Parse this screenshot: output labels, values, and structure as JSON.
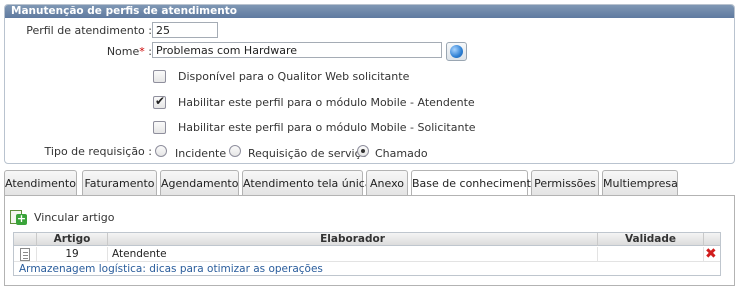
{
  "form": {
    "title": "Manutenção de perfis de atendimento",
    "perfil_label": "Perfil de atendimento :",
    "perfil_value": "25",
    "nome_label": "Nome",
    "nome_required": "*",
    "nome_colon": ":",
    "nome_value": "Problemas com Hardware",
    "checkboxes": [
      {
        "label": "Disponível para o Qualitor Web solicitante",
        "checked": false
      },
      {
        "label": "Habilitar este perfil para o módulo Mobile - Atendente",
        "checked": true
      },
      {
        "label": "Habilitar este perfil para o módulo Mobile - Solicitante",
        "checked": false
      }
    ],
    "tipo_label": "Tipo de requisição :",
    "radios": [
      {
        "label": "Incidente",
        "selected": false
      },
      {
        "label": "Requisição de serviço",
        "selected": false
      },
      {
        "label": "Chamado",
        "selected": true
      }
    ]
  },
  "tabs": [
    {
      "label": "Atendimento",
      "active": false
    },
    {
      "label": "Faturamento",
      "active": false
    },
    {
      "label": "Agendamento",
      "active": false
    },
    {
      "label": "Atendimento tela única",
      "active": false
    },
    {
      "label": "Anexo",
      "active": false
    },
    {
      "label": "Base de conhecimento",
      "active": true
    },
    {
      "label": "Permissões",
      "active": false
    },
    {
      "label": "Multiempresa",
      "active": false
    }
  ],
  "knowledge": {
    "add_label": "Vincular artigo",
    "columns": [
      "Artigo",
      "Elaborador",
      "Validade"
    ],
    "rows": [
      {
        "artigo": "19",
        "elaborador": "Atendente",
        "validade": ""
      }
    ],
    "article_title": "Armazenagem logística: dicas para otimizar as operações"
  },
  "icons": {
    "lookup": "globe-icon",
    "add": "add-document-icon",
    "row": "document-icon",
    "delete": "delete-x-icon"
  }
}
